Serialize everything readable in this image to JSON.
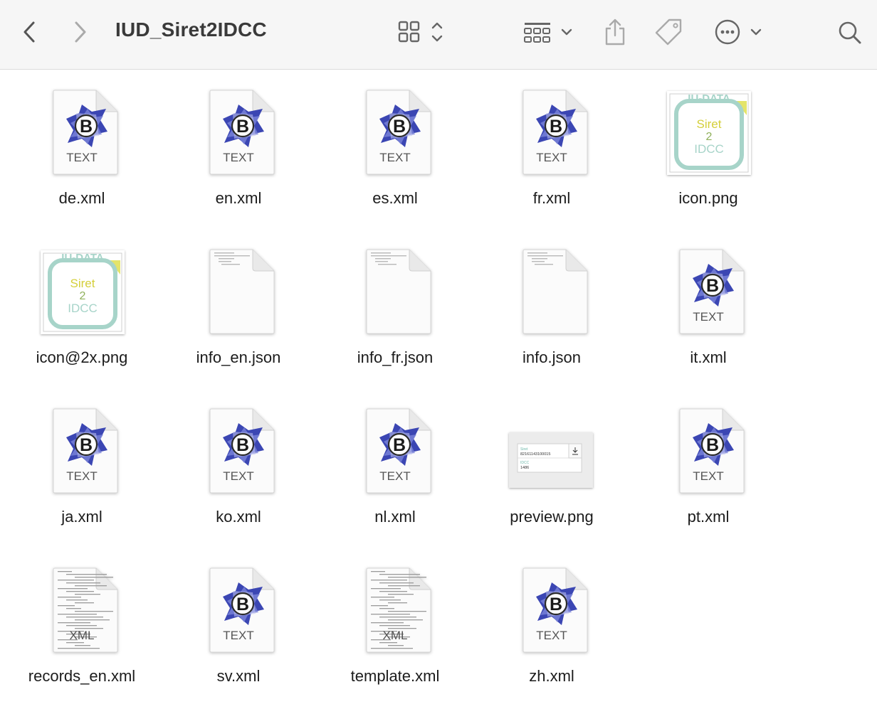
{
  "window": {
    "title": "IUD_Siret2IDCC"
  },
  "toolbar": {
    "back_icon": "chevron-left-icon",
    "forward_icon": "chevron-right-icon",
    "view_icon": "icon-grid-view-icon",
    "group_icon": "group-by-icon",
    "share_icon": "share-icon",
    "tag_icon": "tag-icon",
    "more_icon": "ellipsis-circle-icon",
    "search_icon": "search-icon"
  },
  "files": [
    {
      "name": "de.xml",
      "kind": "bbedit-text",
      "badge": "TEXT"
    },
    {
      "name": "en.xml",
      "kind": "bbedit-text",
      "badge": "TEXT"
    },
    {
      "name": "es.xml",
      "kind": "bbedit-text",
      "badge": "TEXT"
    },
    {
      "name": "fr.xml",
      "kind": "bbedit-text",
      "badge": "TEXT"
    },
    {
      "name": "icon.png",
      "kind": "image-icon"
    },
    {
      "name": "icon@2x.png",
      "kind": "image-icon"
    },
    {
      "name": "info_en.json",
      "kind": "json"
    },
    {
      "name": "info_fr.json",
      "kind": "json"
    },
    {
      "name": "info.json",
      "kind": "json"
    },
    {
      "name": "it.xml",
      "kind": "bbedit-text",
      "badge": "TEXT"
    },
    {
      "name": "ja.xml",
      "kind": "bbedit-text",
      "badge": "TEXT"
    },
    {
      "name": "ko.xml",
      "kind": "bbedit-text",
      "badge": "TEXT"
    },
    {
      "name": "nl.xml",
      "kind": "bbedit-text",
      "badge": "TEXT"
    },
    {
      "name": "preview.png",
      "kind": "image-preview"
    },
    {
      "name": "pt.xml",
      "kind": "bbedit-text",
      "badge": "TEXT"
    },
    {
      "name": "records_en.xml",
      "kind": "xml",
      "badge": "XML"
    },
    {
      "name": "sv.xml",
      "kind": "bbedit-text",
      "badge": "TEXT"
    },
    {
      "name": "template.xml",
      "kind": "xml",
      "badge": "XML"
    },
    {
      "name": "zh.xml",
      "kind": "bbedit-text",
      "badge": "TEXT"
    }
  ],
  "icon_art": {
    "header": "IU-DATA",
    "line1": "Siret",
    "line2": "2",
    "line3": "IDCC"
  },
  "preview_art": {
    "field1_label": "Siret",
    "field1_value": "82161143100015",
    "field2_label": "IDCC",
    "field2_value": "1486"
  },
  "colors": {
    "bbedit_blue": "#4a56c0",
    "teal": "#9fd3c7",
    "yellow": "#e0e06a"
  }
}
